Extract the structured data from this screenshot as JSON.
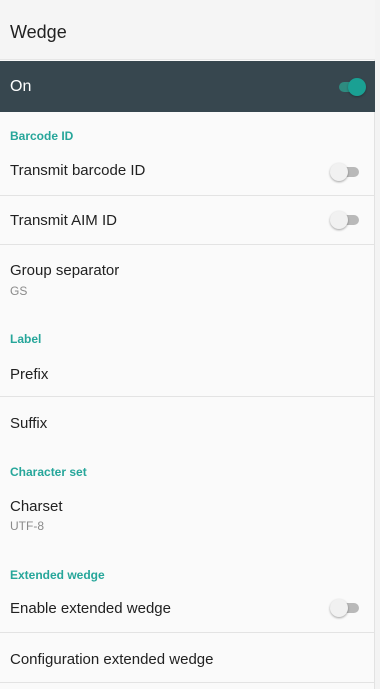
{
  "app_bar": {
    "title": "Wedge"
  },
  "master_switch": {
    "label": "On",
    "checked": true
  },
  "sections": {
    "barcode_id": "Barcode ID",
    "label": "Label",
    "character_set": "Character set",
    "extended_wedge": "Extended wedge"
  },
  "items": {
    "transmit_barcode_id": {
      "title": "Transmit barcode ID",
      "checked": false
    },
    "transmit_aim_id": {
      "title": "Transmit AIM ID",
      "checked": false
    },
    "group_separator": {
      "title": "Group separator",
      "value": "GS"
    },
    "prefix": {
      "title": "Prefix"
    },
    "suffix": {
      "title": "Suffix"
    },
    "charset": {
      "title": "Charset",
      "value": "UTF-8"
    },
    "enable_extended_wedge": {
      "title": "Enable extended wedge",
      "checked": false
    },
    "configuration_extended_wedge": {
      "title": "Configuration extended wedge"
    }
  },
  "colors": {
    "accent": "#26a69a",
    "master_bar": "#37474f",
    "background": "#fafafa"
  }
}
